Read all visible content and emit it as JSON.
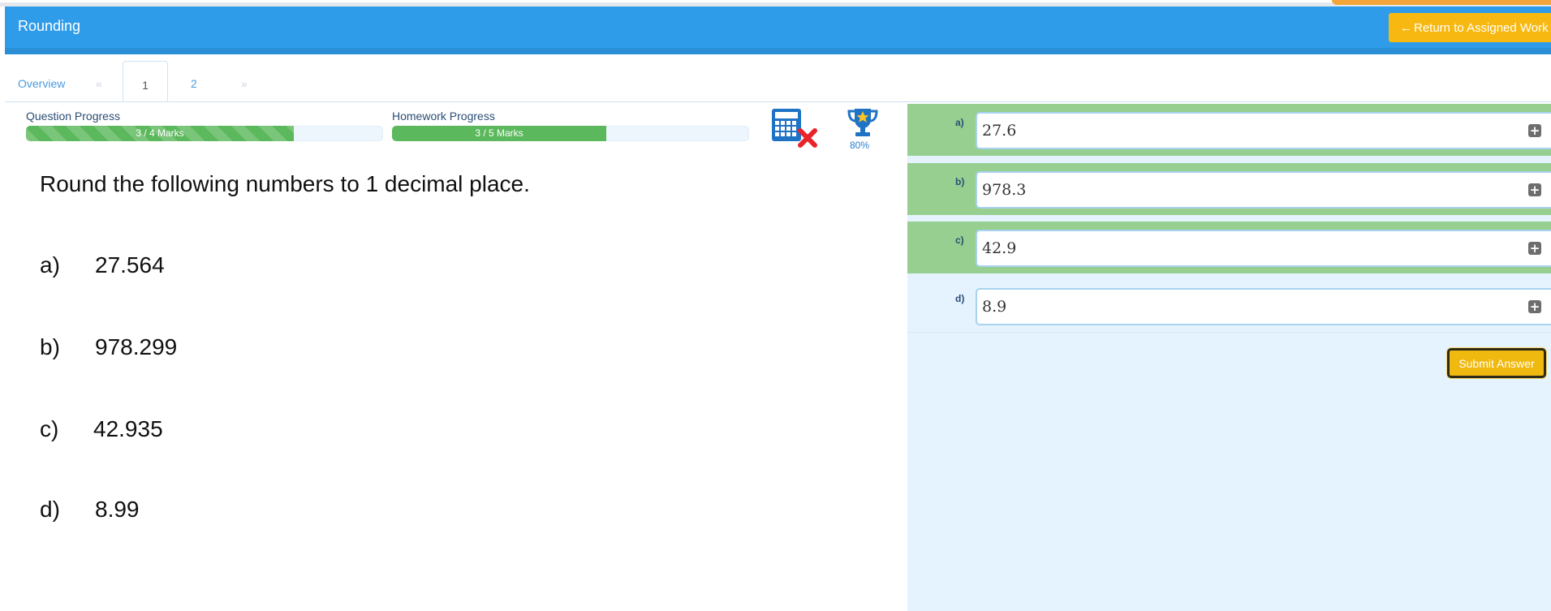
{
  "header": {
    "title": "Rounding",
    "return_label": "Return to Assigned Work"
  },
  "tabs": {
    "overview": "Overview",
    "prev": "«",
    "tab1": "1",
    "tab2": "2",
    "next": "»"
  },
  "progress": {
    "question_label": "Question Progress",
    "question_text": "3 / 4 Marks",
    "question_fraction": 0.75,
    "homework_label": "Homework Progress",
    "homework_text": "3 / 5 Marks",
    "homework_fraction": 0.6
  },
  "trophy_percent": "80%",
  "icons": {
    "calculator": "calculator-not-allowed-icon",
    "trophy": "trophy-icon",
    "plus": "plus-square-icon",
    "arrow": "arrow-left-icon"
  },
  "colors": {
    "header": "#2f9ce9",
    "accent_yellow": "#f7b811",
    "correct_green": "#96cf8f",
    "progress_green": "#5cb85c",
    "answer_panel": "#e4f3fd"
  },
  "question": {
    "prompt": "Round the following numbers to 1 decimal place.",
    "parts": [
      {
        "letter": "a)",
        "value": "27.564"
      },
      {
        "letter": "b)",
        "value": "978.299"
      },
      {
        "letter": "c)",
        "value": "42.935"
      },
      {
        "letter": "d)",
        "value": "8.99"
      }
    ]
  },
  "answers": [
    {
      "letter": "a)",
      "value": "27.6"
    },
    {
      "letter": "b)",
      "value": "978.3"
    },
    {
      "letter": "c)",
      "value": "42.9"
    },
    {
      "letter": "d)",
      "value": "8.9"
    }
  ],
  "submit_label": "Submit Answer"
}
